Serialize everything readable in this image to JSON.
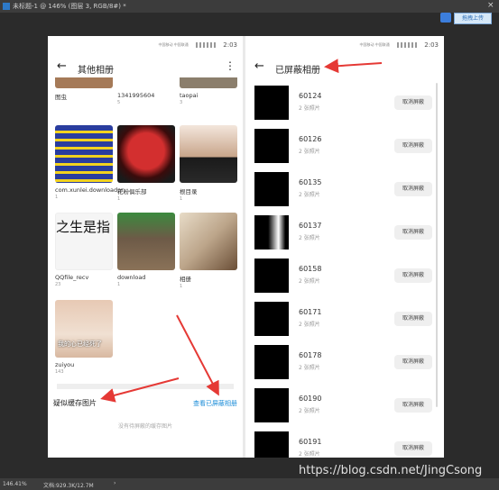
{
  "window": {
    "title": "未标题-1 @ 146% (图层 3, RGB/8#) *",
    "close": "×"
  },
  "top_button": {
    "label": "拖拽上传"
  },
  "status_bar": {
    "time": "2:03",
    "carrier_small": "中国移动\n中国联通"
  },
  "left_pane": {
    "back": "←",
    "title": "其他相册",
    "menu": "⋮",
    "top_row": [
      {
        "name": "图虫",
        "count": ""
      },
      {
        "name": "1341995604",
        "count": "5"
      },
      {
        "name": "taopai",
        "count": "3"
      }
    ],
    "albums": [
      {
        "name": "com.xunlei.downloadpr",
        "count": "1",
        "color": "#2a3d9e"
      },
      {
        "name": "花粉俱乐部",
        "count": "1",
        "color": "#b71c1c"
      },
      {
        "name": "根目录",
        "count": "1",
        "color": "#c8a58a"
      },
      {
        "name": "QQfile_recv",
        "count": "23",
        "color": "#f5f5f5",
        "thumb_text": "之生是指"
      },
      {
        "name": "download",
        "count": "1",
        "color": "#6d5a47"
      },
      {
        "name": "相册",
        "count": "1",
        "color": "#bca58a"
      },
      {
        "name": "zuiyou",
        "count": "143",
        "color": "#e7c9b4",
        "thumb_text": "我的心已经死了"
      }
    ],
    "section_label": "疑似缓存图片",
    "section_link": "查看已屏蔽相册",
    "empty_text": "没有待屏蔽的缓存图片"
  },
  "right_pane": {
    "back": "←",
    "title": "已屏蔽相册",
    "folders": [
      {
        "name": "60124",
        "count": "2 张照片",
        "button": "取消屏蔽"
      },
      {
        "name": "60126",
        "count": "2 张照片",
        "button": "取消屏蔽"
      },
      {
        "name": "60135",
        "count": "2 张照片",
        "button": "取消屏蔽"
      },
      {
        "name": "60137",
        "count": "2 张照片",
        "button": "取消屏蔽"
      },
      {
        "name": "60158",
        "count": "2 张照片",
        "button": "取消屏蔽"
      },
      {
        "name": "60171",
        "count": "2 张照片",
        "button": "取消屏蔽"
      },
      {
        "name": "60178",
        "count": "2 张照片",
        "button": "取消屏蔽"
      },
      {
        "name": "60190",
        "count": "2 张照片",
        "button": "取消屏蔽"
      },
      {
        "name": "60191",
        "count": "2 张照片",
        "button": "取消屏蔽"
      }
    ]
  },
  "watermark": "https://blog.csdn.net/JingCsong",
  "footer": {
    "zoom": "146.41%",
    "doc": "文档:929.3K/12.7M",
    "caret": "›"
  },
  "colors": {
    "accent_link": "#1a8cd8",
    "arrow": "#e53935",
    "background": "#2b2b2b"
  }
}
